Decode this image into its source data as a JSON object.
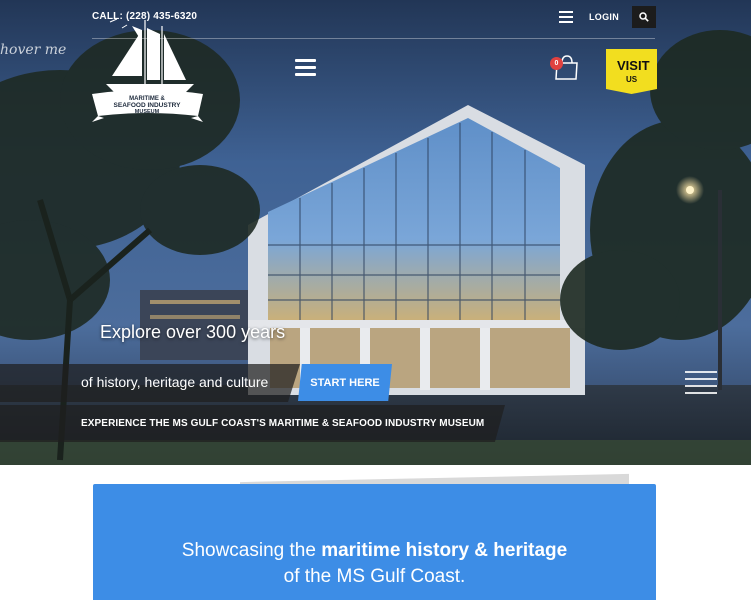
{
  "topbar": {
    "phone": "CALL: (228) 435-6320",
    "login_label": "LOGIN"
  },
  "logo": {
    "line1": "MARITIME &",
    "line2": "SEAFOOD INDUSTRY",
    "line3": "MUSEUM",
    "hover_text": "hover me"
  },
  "cart": {
    "count": "0"
  },
  "visit_button": {
    "top": "VISIT",
    "bottom": "US"
  },
  "hero": {
    "headline1": "Explore over 300 years",
    "headline2": "of history, heritage and culture",
    "cta_label": "START HERE",
    "tagline": "EXPERIENCE THE MS GULF COAST'S MARITIME & SEAFOOD INDUSTRY MUSEUM"
  },
  "intro": {
    "line1_prefix": "Showcasing the ",
    "line1_bold": "maritime history & heritage",
    "line2": "of the MS Gulf Coast."
  },
  "colors": {
    "accent_blue": "#3d8de6",
    "visit_yellow": "#f2de1f",
    "badge_red": "#e0413f"
  },
  "icons": [
    "search-icon",
    "menu-icon",
    "hamburger-icon",
    "cart-icon",
    "slider-icon",
    "ship-logo"
  ]
}
